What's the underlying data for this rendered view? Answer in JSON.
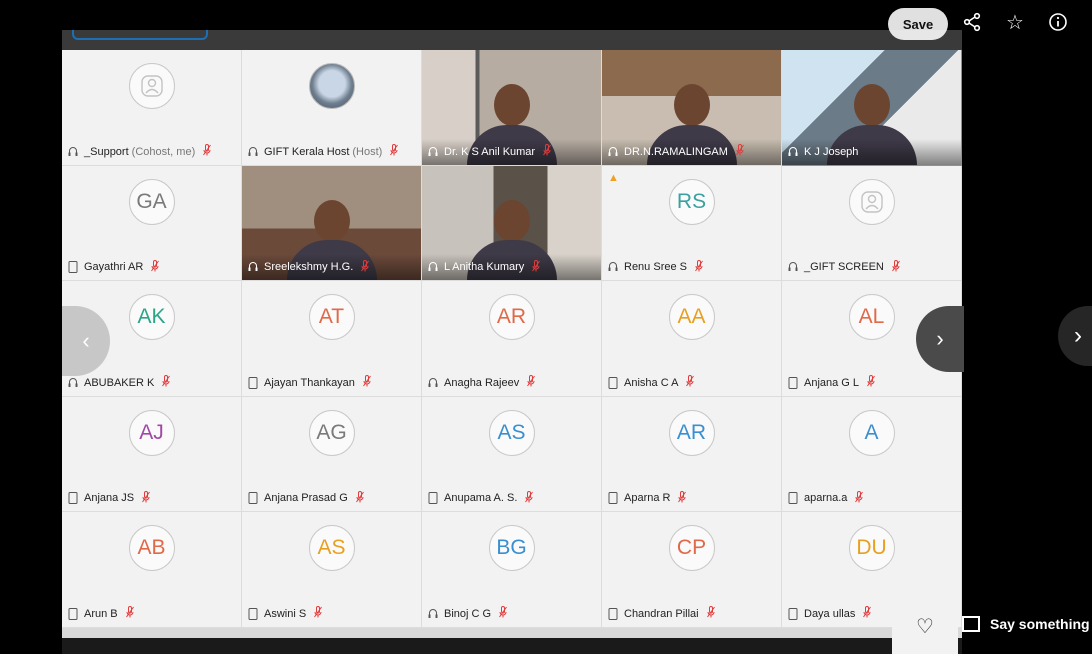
{
  "overlay": {
    "save_label": "Save",
    "say_something_label": "Say something",
    "share_icon": "share-icon",
    "star_icon": "star-icon",
    "info_icon": "info-icon",
    "heart_icon": "heart-icon"
  },
  "participants": [
    {
      "name": "_Support",
      "role": "(Cohost, me)",
      "initials": "",
      "kind": "person",
      "device": "headset",
      "color": "#999999"
    },
    {
      "name": "GIFT Kerala Host",
      "role": "(Host)",
      "initials": "",
      "kind": "logo",
      "device": "headset",
      "color": "#999999"
    },
    {
      "name": "Dr. K S Anil Kumar",
      "role": "",
      "initials": "",
      "kind": "video",
      "device": "headset",
      "color": "#999999"
    },
    {
      "name": "DR.N.RAMALINGAM",
      "role": "",
      "initials": "",
      "kind": "video",
      "device": "headset",
      "color": "#999999"
    },
    {
      "name": "K J Joseph",
      "role": "",
      "initials": "",
      "kind": "video",
      "device": "headset",
      "color": "#999999",
      "active": true
    },
    {
      "name": "Gayathri AR",
      "role": "",
      "initials": "GA",
      "kind": "initials",
      "device": "phone",
      "color": "#7a7a7a"
    },
    {
      "name": "Sreelekshmy H.G.",
      "role": "",
      "initials": "",
      "kind": "video",
      "device": "headset",
      "color": "#999999"
    },
    {
      "name": "L Anitha Kumary",
      "role": "",
      "initials": "",
      "kind": "video",
      "device": "headset",
      "color": "#999999"
    },
    {
      "name": "Renu Sree S",
      "role": "",
      "initials": "RS",
      "kind": "initials",
      "device": "headset",
      "color": "#3aa0a0",
      "warn": true
    },
    {
      "name": "_GIFT SCREEN",
      "role": "",
      "initials": "",
      "kind": "person",
      "device": "headset",
      "color": "#999999"
    },
    {
      "name": "ABUBAKER K",
      "role": "",
      "initials": "AK",
      "kind": "initials",
      "device": "headset",
      "color": "#2aa58a"
    },
    {
      "name": "Ajayan Thankayan",
      "role": "",
      "initials": "AT",
      "kind": "initials",
      "device": "phone",
      "color": "#e0694a"
    },
    {
      "name": "Anagha Rajeev",
      "role": "",
      "initials": "AR",
      "kind": "initials",
      "device": "headset",
      "color": "#e0694a"
    },
    {
      "name": "Anisha C A",
      "role": "",
      "initials": "AA",
      "kind": "initials",
      "device": "phone",
      "color": "#e8a020"
    },
    {
      "name": "Anjana G L",
      "role": "",
      "initials": "AL",
      "kind": "initials",
      "device": "phone",
      "color": "#e0694a"
    },
    {
      "name": "Anjana JS",
      "role": "",
      "initials": "AJ",
      "kind": "initials",
      "device": "phone",
      "color": "#a04aa6"
    },
    {
      "name": "Anjana Prasad G",
      "role": "",
      "initials": "AG",
      "kind": "initials",
      "device": "phone",
      "color": "#7a7a7a"
    },
    {
      "name": "Anupama A. S.",
      "role": "",
      "initials": "AS",
      "kind": "initials",
      "device": "phone",
      "color": "#3a8fd0"
    },
    {
      "name": "Aparna R",
      "role": "",
      "initials": "AR",
      "kind": "initials",
      "device": "phone",
      "color": "#3a8fd0"
    },
    {
      "name": "aparna.a",
      "role": "",
      "initials": "A",
      "kind": "initials",
      "device": "phone",
      "color": "#3a8fd0"
    },
    {
      "name": "Arun B",
      "role": "",
      "initials": "AB",
      "kind": "initials",
      "device": "phone",
      "color": "#e0694a"
    },
    {
      "name": "Aswini S",
      "role": "",
      "initials": "AS",
      "kind": "initials",
      "device": "phone",
      "color": "#e8a020"
    },
    {
      "name": "Binoj C G",
      "role": "",
      "initials": "BG",
      "kind": "initials",
      "device": "headset",
      "color": "#3a8fd0"
    },
    {
      "name": "Chandran Pillai",
      "role": "",
      "initials": "CP",
      "kind": "initials",
      "device": "phone",
      "color": "#e0694a"
    },
    {
      "name": "Daya ullas",
      "role": "",
      "initials": "DU",
      "kind": "initials",
      "device": "phone",
      "color": "#e8a020"
    }
  ]
}
